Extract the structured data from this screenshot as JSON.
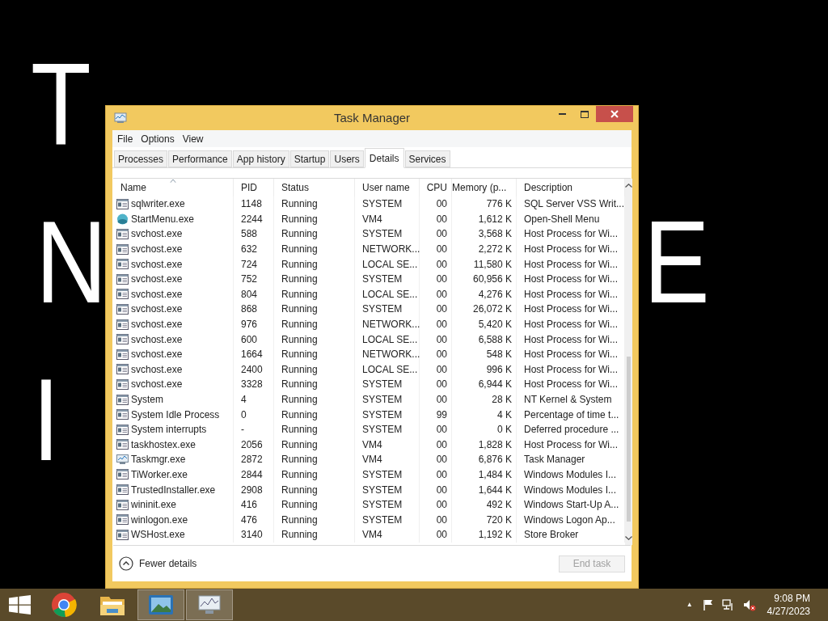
{
  "desktop": {
    "lines": [
      "T",
      "N",
      "E",
      "I"
    ]
  },
  "window": {
    "title": "Task Manager"
  },
  "menu": [
    "File",
    "Options",
    "View"
  ],
  "tabs": [
    {
      "label": "Processes",
      "selected": false
    },
    {
      "label": "Performance",
      "selected": false
    },
    {
      "label": "App history",
      "selected": false
    },
    {
      "label": "Startup",
      "selected": false
    },
    {
      "label": "Users",
      "selected": false
    },
    {
      "label": "Details",
      "selected": true
    },
    {
      "label": "Services",
      "selected": false
    }
  ],
  "table": {
    "columns": [
      {
        "label": "Name",
        "sorted": true
      },
      {
        "label": "PID",
        "sorted": false
      },
      {
        "label": "Status",
        "sorted": false
      },
      {
        "label": "User name",
        "sorted": false
      },
      {
        "label": "CPU",
        "sorted": false
      },
      {
        "label": "Memory (p...",
        "sorted": false
      },
      {
        "label": "Description",
        "sorted": false
      }
    ],
    "rows": [
      {
        "kind": "app",
        "cells": [
          "sqlwriter.exe",
          "1148",
          "Running",
          "SYSTEM",
          "00",
          "776 K",
          "SQL Server VSS Writ..."
        ]
      },
      {
        "kind": "shell",
        "cells": [
          "StartMenu.exe",
          "2244",
          "Running",
          "VM4",
          "00",
          "1,612 K",
          "Open-Shell Menu"
        ]
      },
      {
        "kind": "app",
        "cells": [
          "svchost.exe",
          "588",
          "Running",
          "SYSTEM",
          "00",
          "3,568 K",
          "Host Process for Wi..."
        ]
      },
      {
        "kind": "app",
        "cells": [
          "svchost.exe",
          "632",
          "Running",
          "NETWORK...",
          "00",
          "2,272 K",
          "Host Process for Wi..."
        ]
      },
      {
        "kind": "app",
        "cells": [
          "svchost.exe",
          "724",
          "Running",
          "LOCAL SE...",
          "00",
          "11,580 K",
          "Host Process for Wi..."
        ]
      },
      {
        "kind": "app",
        "cells": [
          "svchost.exe",
          "752",
          "Running",
          "SYSTEM",
          "00",
          "60,956 K",
          "Host Process for Wi..."
        ]
      },
      {
        "kind": "app",
        "cells": [
          "svchost.exe",
          "804",
          "Running",
          "LOCAL SE...",
          "00",
          "4,276 K",
          "Host Process for Wi..."
        ]
      },
      {
        "kind": "app",
        "cells": [
          "svchost.exe",
          "868",
          "Running",
          "SYSTEM",
          "00",
          "26,072 K",
          "Host Process for Wi..."
        ]
      },
      {
        "kind": "app",
        "cells": [
          "svchost.exe",
          "976",
          "Running",
          "NETWORK...",
          "00",
          "5,420 K",
          "Host Process for Wi..."
        ]
      },
      {
        "kind": "app",
        "cells": [
          "svchost.exe",
          "600",
          "Running",
          "LOCAL SE...",
          "00",
          "6,588 K",
          "Host Process for Wi..."
        ]
      },
      {
        "kind": "app",
        "cells": [
          "svchost.exe",
          "1664",
          "Running",
          "NETWORK...",
          "00",
          "548 K",
          "Host Process for Wi..."
        ]
      },
      {
        "kind": "app",
        "cells": [
          "svchost.exe",
          "2400",
          "Running",
          "LOCAL SE...",
          "00",
          "996 K",
          "Host Process for Wi..."
        ]
      },
      {
        "kind": "app",
        "cells": [
          "svchost.exe",
          "3328",
          "Running",
          "SYSTEM",
          "00",
          "6,944 K",
          "Host Process for Wi..."
        ]
      },
      {
        "kind": "app",
        "cells": [
          "System",
          "4",
          "Running",
          "SYSTEM",
          "00",
          "28 K",
          "NT Kernel & System"
        ]
      },
      {
        "kind": "app",
        "cells": [
          "System Idle Process",
          "0",
          "Running",
          "SYSTEM",
          "99",
          "4 K",
          "Percentage of time t..."
        ]
      },
      {
        "kind": "app",
        "cells": [
          "System interrupts",
          "-",
          "Running",
          "SYSTEM",
          "00",
          "0 K",
          "Deferred procedure ..."
        ]
      },
      {
        "kind": "app",
        "cells": [
          "taskhostex.exe",
          "2056",
          "Running",
          "VM4",
          "00",
          "1,828 K",
          "Host Process for Wi..."
        ]
      },
      {
        "kind": "chart",
        "cells": [
          "Taskmgr.exe",
          "2872",
          "Running",
          "VM4",
          "00",
          "6,876 K",
          "Task Manager"
        ]
      },
      {
        "kind": "app",
        "cells": [
          "TiWorker.exe",
          "2844",
          "Running",
          "SYSTEM",
          "00",
          "1,484 K",
          "Windows Modules I..."
        ]
      },
      {
        "kind": "app",
        "cells": [
          "TrustedInstaller.exe",
          "2908",
          "Running",
          "SYSTEM",
          "00",
          "1,644 K",
          "Windows Modules I..."
        ]
      },
      {
        "kind": "app",
        "cells": [
          "wininit.exe",
          "416",
          "Running",
          "SYSTEM",
          "00",
          "492 K",
          "Windows Start-Up A..."
        ]
      },
      {
        "kind": "app",
        "cells": [
          "winlogon.exe",
          "476",
          "Running",
          "SYSTEM",
          "00",
          "720 K",
          "Windows Logon Ap..."
        ]
      },
      {
        "kind": "app",
        "cells": [
          "WSHost.exe",
          "3140",
          "Running",
          "VM4",
          "00",
          "1,192 K",
          "Store Broker"
        ]
      }
    ]
  },
  "footer": {
    "toggle": "Fewer details",
    "button": {
      "label": "End task",
      "disabled": true
    }
  },
  "taskbar": {
    "apps": [
      {
        "kind": "browser",
        "selected": false
      },
      {
        "kind": "folder",
        "selected": false
      },
      {
        "kind": "photos",
        "selected": true
      },
      {
        "kind": "taskmgr",
        "selected": true
      }
    ],
    "tray": {
      "caret": "▲",
      "time": "9:08 PM",
      "date": "4/27/2023"
    }
  }
}
